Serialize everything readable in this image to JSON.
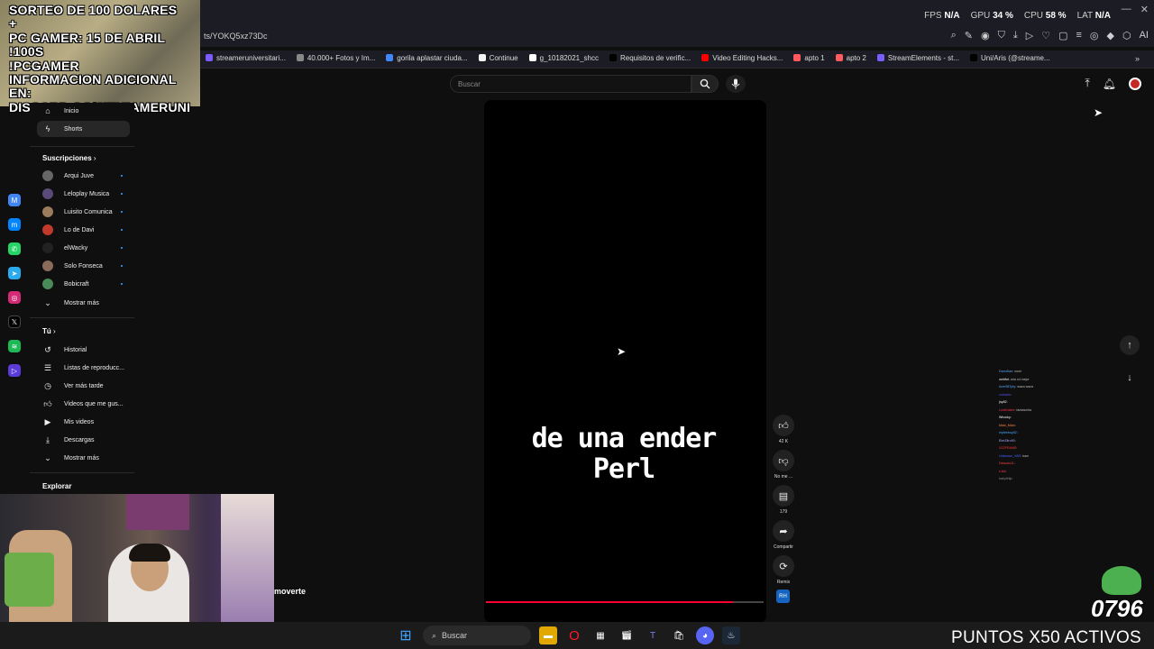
{
  "window": {
    "stats": [
      {
        "label": "FPS",
        "value": "N/A"
      },
      {
        "label": "GPU",
        "value": "34 %"
      },
      {
        "label": "CPU",
        "value": "58 %"
      },
      {
        "label": "LAT",
        "value": "N/A"
      }
    ]
  },
  "address": {
    "url": "ts/YOKQ5xz73Dc"
  },
  "bookmarks": [
    {
      "label": "streameruniversitari...",
      "color": "#7b5cff"
    },
    {
      "label": "40.000+ Fotos y Im...",
      "color": "#888888"
    },
    {
      "label": "gorila aplastar ciuda...",
      "color": "#4285f4"
    },
    {
      "label": "Continue",
      "color": "#f5f5f5"
    },
    {
      "label": "g_10182021_shcc",
      "color": "#ffffff"
    },
    {
      "label": "Requisitos de verific...",
      "color": "#000000"
    },
    {
      "label": "Video Editing Hacks...",
      "color": "#ff0000"
    },
    {
      "label": "apto 1",
      "color": "#ff5a5f"
    },
    {
      "label": "apto 2",
      "color": "#ff5a5f"
    },
    {
      "label": "StreamElements - st...",
      "color": "#7b5cff"
    },
    {
      "label": "Uni/Aris (@streame...",
      "color": "#000000"
    }
  ],
  "promo": {
    "lines": [
      "SORTEO DE 100 DOLARES",
      "+",
      "PC GAMER: 15 DE ABRIL",
      "!100S",
      "!PCGAMER",
      "INFORMACION ADICIONAL EN:",
      "DISCORD.GG/STREAMERUNI"
    ]
  },
  "sidebar": {
    "top": [
      {
        "label": "Inicio",
        "icon": "home-icon"
      },
      {
        "label": "Shorts",
        "icon": "shorts-icon",
        "active": true
      }
    ],
    "subscriptions_title": "Suscripciones",
    "subscriptions": [
      {
        "label": "Arqui Juve",
        "color": "#666"
      },
      {
        "label": "Leloplay Musica",
        "color": "#5a4a7a"
      },
      {
        "label": "Luisito Comunica",
        "color": "#9a7b5b"
      },
      {
        "label": "Lo de Davi",
        "color": "#c0392b"
      },
      {
        "label": "elWacky",
        "color": "#222"
      },
      {
        "label": "Solo Fonseca",
        "color": "#8a6a5a"
      },
      {
        "label": "Bobicraft",
        "color": "#4a8a5a"
      }
    ],
    "show_more": "Mostrar más",
    "you_title": "Tú",
    "you_items": [
      {
        "label": "Historial",
        "icon": "history-icon"
      },
      {
        "label": "Listas de reproducc...",
        "icon": "playlist-icon"
      },
      {
        "label": "Ver más tarde",
        "icon": "clock-icon"
      },
      {
        "label": "Videos que me gus...",
        "icon": "like-icon"
      },
      {
        "label": "Mis videos",
        "icon": "video-icon"
      },
      {
        "label": "Descargas",
        "icon": "download-icon"
      }
    ],
    "show_more_2": "Mostrar más",
    "explore_title": "Explorar"
  },
  "search": {
    "placeholder": "Buscar"
  },
  "video": {
    "caption_line1": "de una ender",
    "caption_line2": "Perl",
    "progress": 0.89
  },
  "actions": {
    "likes": "42 K",
    "dislike": "No me ...",
    "comments": "179",
    "share": "Compartir",
    "remix": "Remix",
    "remix_thumb": "RH"
  },
  "chat": [
    {
      "user": "DannDan",
      "msg": "nomi",
      "color": "#55aaff"
    },
    {
      "user": "oshtfot",
      "msg": "aria xd mejor",
      "color": "#ffffff"
    },
    {
      "user": "Axer987pty",
      "msg": "waza waza",
      "color": "#55aaff"
    },
    {
      "user": "zulowlin",
      "msg": "",
      "color": "#5555ff"
    },
    {
      "user": "jny82",
      "msg": "",
      "color": "#ffffff"
    },
    {
      "user": "LordKaiser",
      "msg": "fantasmita",
      "color": "#ff3355"
    },
    {
      "user": "Wirocky",
      "msg": "",
      "color": "#ffffff"
    },
    {
      "user": "Malo_Malo",
      "msg": "",
      "color": "#ff8844"
    },
    {
      "user": "elpitreboy82",
      "msg": "",
      "color": "#44aaff"
    },
    {
      "user": "ElerZitro90",
      "msg": "",
      "color": "#aaaaff"
    },
    {
      "user": "XZZFRAME",
      "msg": "",
      "color": "#ff3333"
    },
    {
      "user": "Unknown_VAR",
      "msg": "bam",
      "color": "#4466ff"
    },
    {
      "user": "Desocio11",
      "msg": "",
      "color": "#ff4444"
    },
    {
      "user": "s.kid",
      "msg": "",
      "color": "#ff3355"
    },
    {
      "user": "babyfelip",
      "msg": "",
      "color": "#888888"
    }
  ],
  "webcam": {
    "overlay_text": "moverte"
  },
  "overlay": {
    "points_text": "PUNTOS X50 ACTIVOS",
    "number": "0796"
  },
  "taskbar": {
    "search": "Buscar"
  }
}
